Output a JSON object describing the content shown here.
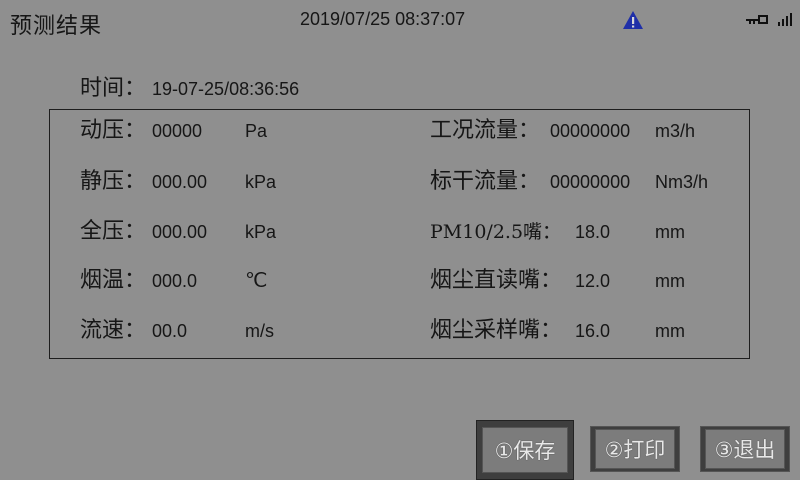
{
  "header": {
    "title": "预测结果",
    "datetime": "2019/07/25 08:37:07",
    "icons": {
      "warning": "warning-icon",
      "key": "key-icon",
      "signal": "signal-icon"
    }
  },
  "time": {
    "label": "时间：",
    "value": "19-07-25/08:36:56"
  },
  "left_params": [
    {
      "label": "动压：",
      "value": "00000",
      "unit": "Pa"
    },
    {
      "label": "静压：",
      "value": "000.00",
      "unit": "kPa"
    },
    {
      "label": "全压：",
      "value": "000.00",
      "unit": "kPa"
    },
    {
      "label": "烟温：",
      "value": "000.0",
      "unit": "℃"
    },
    {
      "label": "流速：",
      "value": "00.0",
      "unit": "m/s"
    }
  ],
  "right_params": [
    {
      "label": "工况流量：",
      "value": "00000000",
      "unit": "m3/h"
    },
    {
      "label": "标干流量：",
      "value": "00000000",
      "unit": "Nm3/h"
    },
    {
      "label": "PM10/2.5嘴：",
      "value": "18.0",
      "unit": "mm"
    },
    {
      "label": "烟尘直读嘴：",
      "value": "12.0",
      "unit": "mm"
    },
    {
      "label": "烟尘采样嘴：",
      "value": "16.0",
      "unit": "mm"
    }
  ],
  "buttons": {
    "save": "①保存",
    "print": "②打印",
    "exit": "③退出"
  },
  "colors": {
    "background": "#8f8f8f",
    "text": "#161616",
    "warning_blue": "#1f2fa8"
  }
}
